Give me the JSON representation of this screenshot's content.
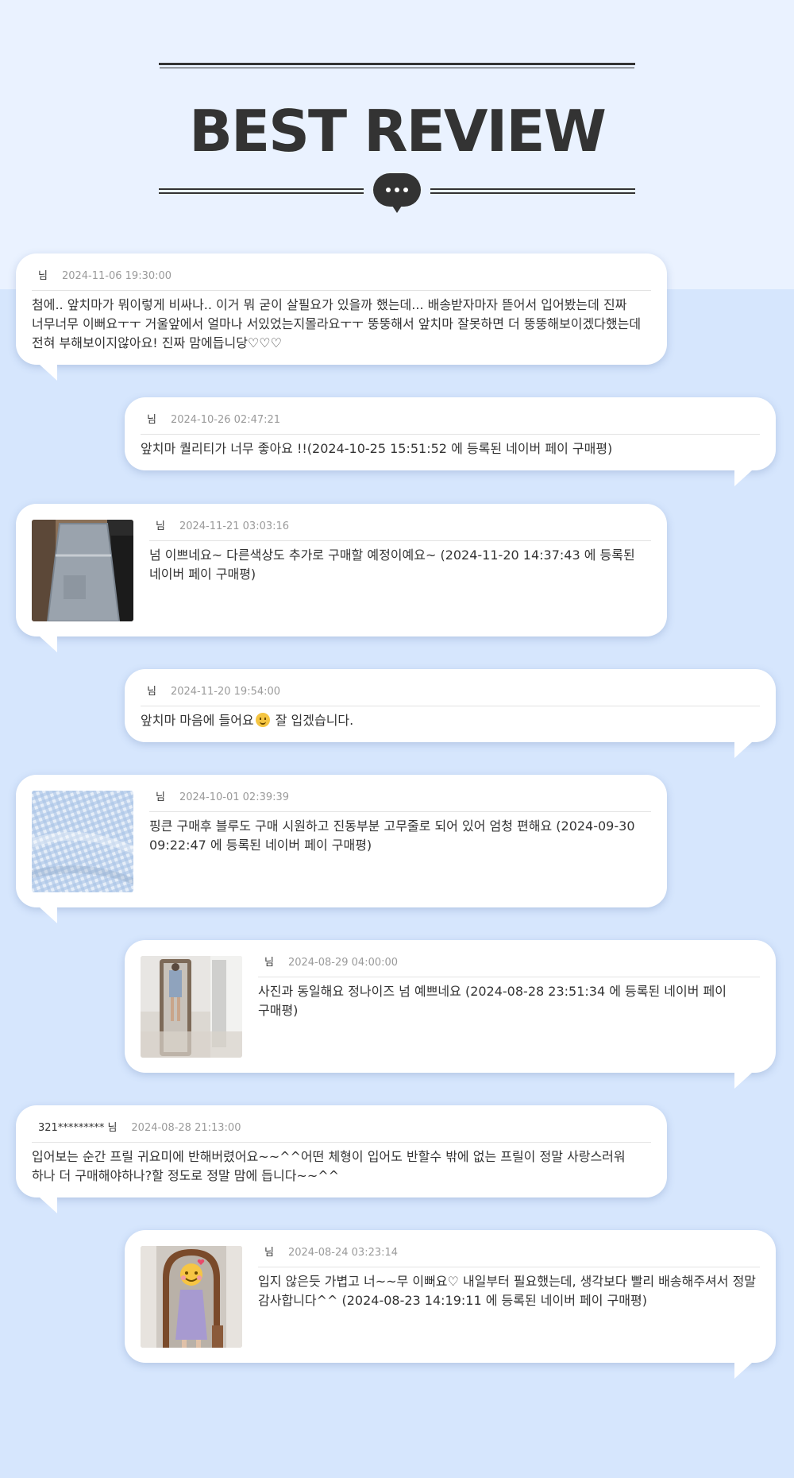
{
  "header": {
    "title": "BEST REVIEW",
    "icon": "speech-bubble-dots-icon"
  },
  "colors": {
    "top_background": "#eaf2ff",
    "page_background": "#d6e6fd",
    "title_color": "#333333",
    "date_color": "#9a9a9a"
  },
  "reviews": [
    {
      "author": "님",
      "date": "2024-11-06 19:30:00",
      "text": "첨에.. 앞치마가 뭐이렇게 비싸나.. 이거 뭐 굳이 살필요가 있을까 했는데... 배송받자마자 뜯어서 입어봤는데 진짜 너무너무 이뻐요ㅜㅜ 거울앞에서 얼마나 서있었는지몰라요ㅜㅜ 뚱뚱해서 앞치마 잘못하면 더 뚱뚱해보이겠다했는데 전혀 부해보이지않아요! 진짜 맘에듭니당♡♡♡",
      "photo": null
    },
    {
      "author": "님",
      "date": "2024-10-26 02:47:21",
      "text": "앞치마 퀄리티가 너무 좋아요 !!(2024-10-25 15:51:52 에 등록된 네이버 페이 구매평)",
      "photo": null
    },
    {
      "author": "님",
      "date": "2024-11-21 03:03:16",
      "text": "넘 이쁘네요~ 다른색상도 추가로 구매할 예정이예요~ (2024-11-20 14:37:43 에 등록된 네이버 페이 구매평)",
      "photo": "apron-on-hanger-photo"
    },
    {
      "author": "님",
      "date": "2024-11-20 19:54:00",
      "text_before_emoji": "앞치마 마음에 들어요",
      "emoji": "smiling-face-emoji",
      "text_after_emoji": " 잘 입겠습니다.",
      "photo": null
    },
    {
      "author": "님",
      "date": "2024-10-01 02:39:39",
      "text": "핑큰 구매후 블루도 구매 시원하고 진동부분 고무줄로 되어 있어 엄청 편해요 (2024-09-30 09:22:47 에 등록된 네이버 페이 구매평)",
      "photo": "gingham-fabric-photo"
    },
    {
      "author": "님",
      "date": "2024-08-29 04:00:00",
      "text": "사진과 동일해요 정나이즈 넘 예쁘네요 (2024-08-28 23:51:34 에 등록된 네이버 페이 구매평)",
      "photo": "mirror-selfie-photo"
    },
    {
      "author": "321********* 님",
      "date": "2024-08-28 21:13:00",
      "text": "입어보는 순간 프릴 귀요미에 반해버렸어요~~^^어떤 체형이 입어도 반할수 밖에 없는 프릴이 정말 사랑스러워 하나 더 구매해야하나?할 정도로 정말 맘에 듭니다~~^^",
      "photo": null
    },
    {
      "author": "님",
      "date": "2024-08-24 03:23:14",
      "text": "입지 않은듯 가볍고 너~~무 이뻐요♡ 내일부터 필요했는데, 생각보다 빨리 배송해주셔서 정말 감사합니다^^ (2024-08-23 14:19:11 에 등록된 네이버 페이 구매평)",
      "photo": "mirror-selfie-emoji-face-photo"
    }
  ]
}
